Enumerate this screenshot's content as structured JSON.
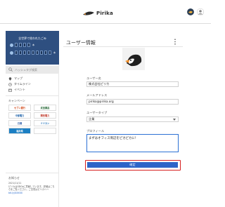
{
  "header": {
    "brand_name": "Pirika",
    "brand_icon": "pirika-logo-icon",
    "icons": [
      "notification-icon",
      "avatar-icon"
    ]
  },
  "sidebar": {
    "counter": {
      "title": "全世界で拾われたごみ",
      "unit_top": "本",
      "unit_bottom": "本"
    },
    "search_placeholder": "ハッシュタグ検索",
    "nav": [
      {
        "label": "マップ",
        "icon": "map-pin-icon"
      },
      {
        "label": "タイムライン",
        "icon": "timeline-icon"
      },
      {
        "label": "イベント",
        "icon": "event-icon"
      }
    ],
    "campaign_heading": "キャンペーン",
    "sponsors": [
      "セブン銀行",
      "武田薬品",
      "中部電力",
      "関西電力",
      "日清",
      "ミツカン",
      "福井県",
      ""
    ],
    "news_heading": "お知らせ",
    "news": {
      "date": "2021/11/11",
      "body": "ピリカはSDGsに貢献しています。詳細はこちらをご覧ください。ご意見はピリカへ→",
      "link": "bit.ly/XXXXX"
    }
  },
  "main": {
    "title": "ユーザー情報",
    "fields": [
      {
        "label": "ユーザー名",
        "value": "株式会社ピリカ"
      },
      {
        "label": "メールアドレス",
        "value": "pirika@pirika.org"
      },
      {
        "label": "ユーザータイプ",
        "value": "企業"
      }
    ],
    "profile_label": "プロフィール",
    "profile_value": "まずはオフィス周辺をピカピカに！",
    "confirm_label": "確定"
  },
  "colors": {
    "accent": "#2d64c8",
    "counter_bg": "#2e4f80",
    "highlight_border": "#d61f1f"
  }
}
